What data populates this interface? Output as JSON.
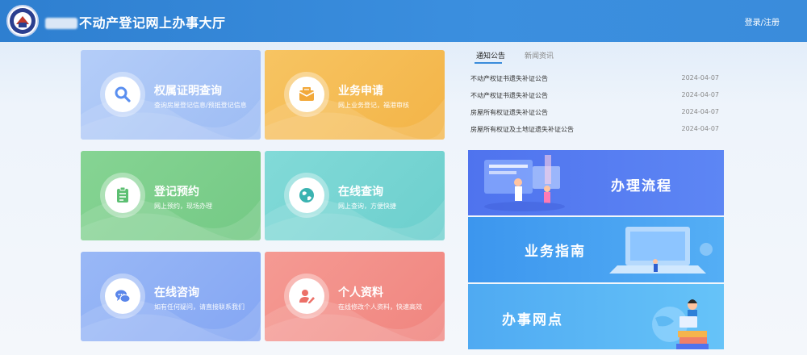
{
  "header": {
    "title": "不动产登记网上办事大厅",
    "login_register": "登录/注册"
  },
  "tiles": [
    {
      "title": "权属证明查询",
      "subtitle": "查询房屋登记信息/预抵登记信息",
      "icon": "search-icon"
    },
    {
      "title": "业务申请",
      "subtitle": "网上业务登记，福港审核",
      "icon": "mail-icon"
    },
    {
      "title": "登记预约",
      "subtitle": "网上预约，现场办理",
      "icon": "clipboard-icon"
    },
    {
      "title": "在线查询",
      "subtitle": "网上查询，方便快捷",
      "icon": "globe-icon"
    },
    {
      "title": "在线咨询",
      "subtitle": "如有任何疑问，请直接联系我们",
      "icon": "chat-icon"
    },
    {
      "title": "个人资料",
      "subtitle": "在线修改个人资料，快速高效",
      "icon": "user-edit-icon"
    }
  ],
  "notices": {
    "tabs": [
      "通知公告",
      "新闻资讯"
    ],
    "items": [
      {
        "title": "不动产权证书遗失补证公告",
        "date": "2024-04-07"
      },
      {
        "title": "不动产权证书遗失补证公告",
        "date": "2024-04-07"
      },
      {
        "title": "房屋所有权证遗失补证公告",
        "date": "2024-04-07"
      },
      {
        "title": "房屋所有权证及土地证遗失补证公告",
        "date": "2024-04-07"
      }
    ]
  },
  "banners": [
    {
      "label": "办理流程"
    },
    {
      "label": "业务指南"
    },
    {
      "label": "办事网点"
    }
  ],
  "colors": {
    "header": "#3a8cdb",
    "tile1": "#a9c6f7",
    "tile2": "#f5bd55",
    "tile3": "#7ecf8c",
    "tile4": "#7bd6d4",
    "tile5": "#8fb0f5",
    "tile6": "#f3918a"
  }
}
